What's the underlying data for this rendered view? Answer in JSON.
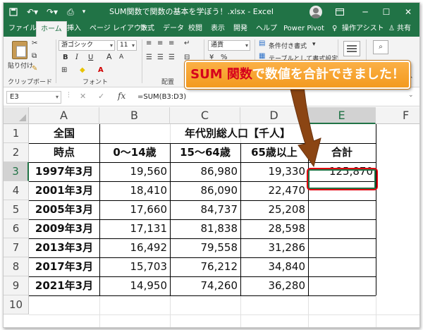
{
  "title_bar": {
    "document_title": "SUM関数で関数の基本を学ぼう！.xlsx  -  Excel",
    "window_buttons": [
      "─",
      "☐",
      "✕"
    ]
  },
  "tabs": [
    "ファイル",
    "ホーム",
    "挿入",
    "ページ レイアウト",
    "数式",
    "データ",
    "校閲",
    "表示",
    "開発",
    "ヘルプ",
    "Power Pivot",
    "操作アシスト",
    "共有"
  ],
  "ribbon": {
    "paste_label": "貼り付け",
    "clipboard_group": "クリップボード",
    "font_name": "游ゴシック",
    "font_size": "11",
    "font_group": "フォント",
    "bold": "B",
    "italic": "I",
    "underline": "U",
    "grow_font": "A",
    "shrink_font": "A",
    "alignment_group": "配置",
    "number_format": "通貨",
    "conditional_format": "条件付き書式",
    "table_format": "テーブルとして書式設定"
  },
  "callout": {
    "highlight": "SUM 関数",
    "text": "で数値を合計できました！"
  },
  "formula_bar": {
    "cell_ref": "E3",
    "formula": "=SUM(B3:D3)"
  },
  "columns": [
    "A",
    "B",
    "C",
    "D",
    "E",
    "F"
  ],
  "rows": [
    "1",
    "2",
    "3",
    "4",
    "5",
    "6",
    "7",
    "8",
    "9",
    "10"
  ],
  "sheet": {
    "a1": "全国",
    "b1": "年代別総人口【千人】",
    "headers": [
      "時点",
      "0～14歳",
      "15～64歳",
      "65歳以上",
      "合計"
    ],
    "data": [
      [
        "1997年3月",
        "19,560",
        "86,980",
        "19,330",
        "125,870"
      ],
      [
        "2001年3月",
        "18,410",
        "86,090",
        "22,470",
        ""
      ],
      [
        "2005年3月",
        "17,660",
        "84,737",
        "25,208",
        ""
      ],
      [
        "2009年3月",
        "17,131",
        "81,838",
        "28,598",
        ""
      ],
      [
        "2013年3月",
        "16,492",
        "79,558",
        "31,286",
        ""
      ],
      [
        "2017年3月",
        "15,703",
        "76,212",
        "34,840",
        ""
      ],
      [
        "2021年3月",
        "14,950",
        "74,260",
        "36,280",
        ""
      ]
    ]
  },
  "colors": {
    "excel_green": "#217346",
    "callout_orange": "#f39a1f",
    "highlight_red": "#e3000f"
  }
}
